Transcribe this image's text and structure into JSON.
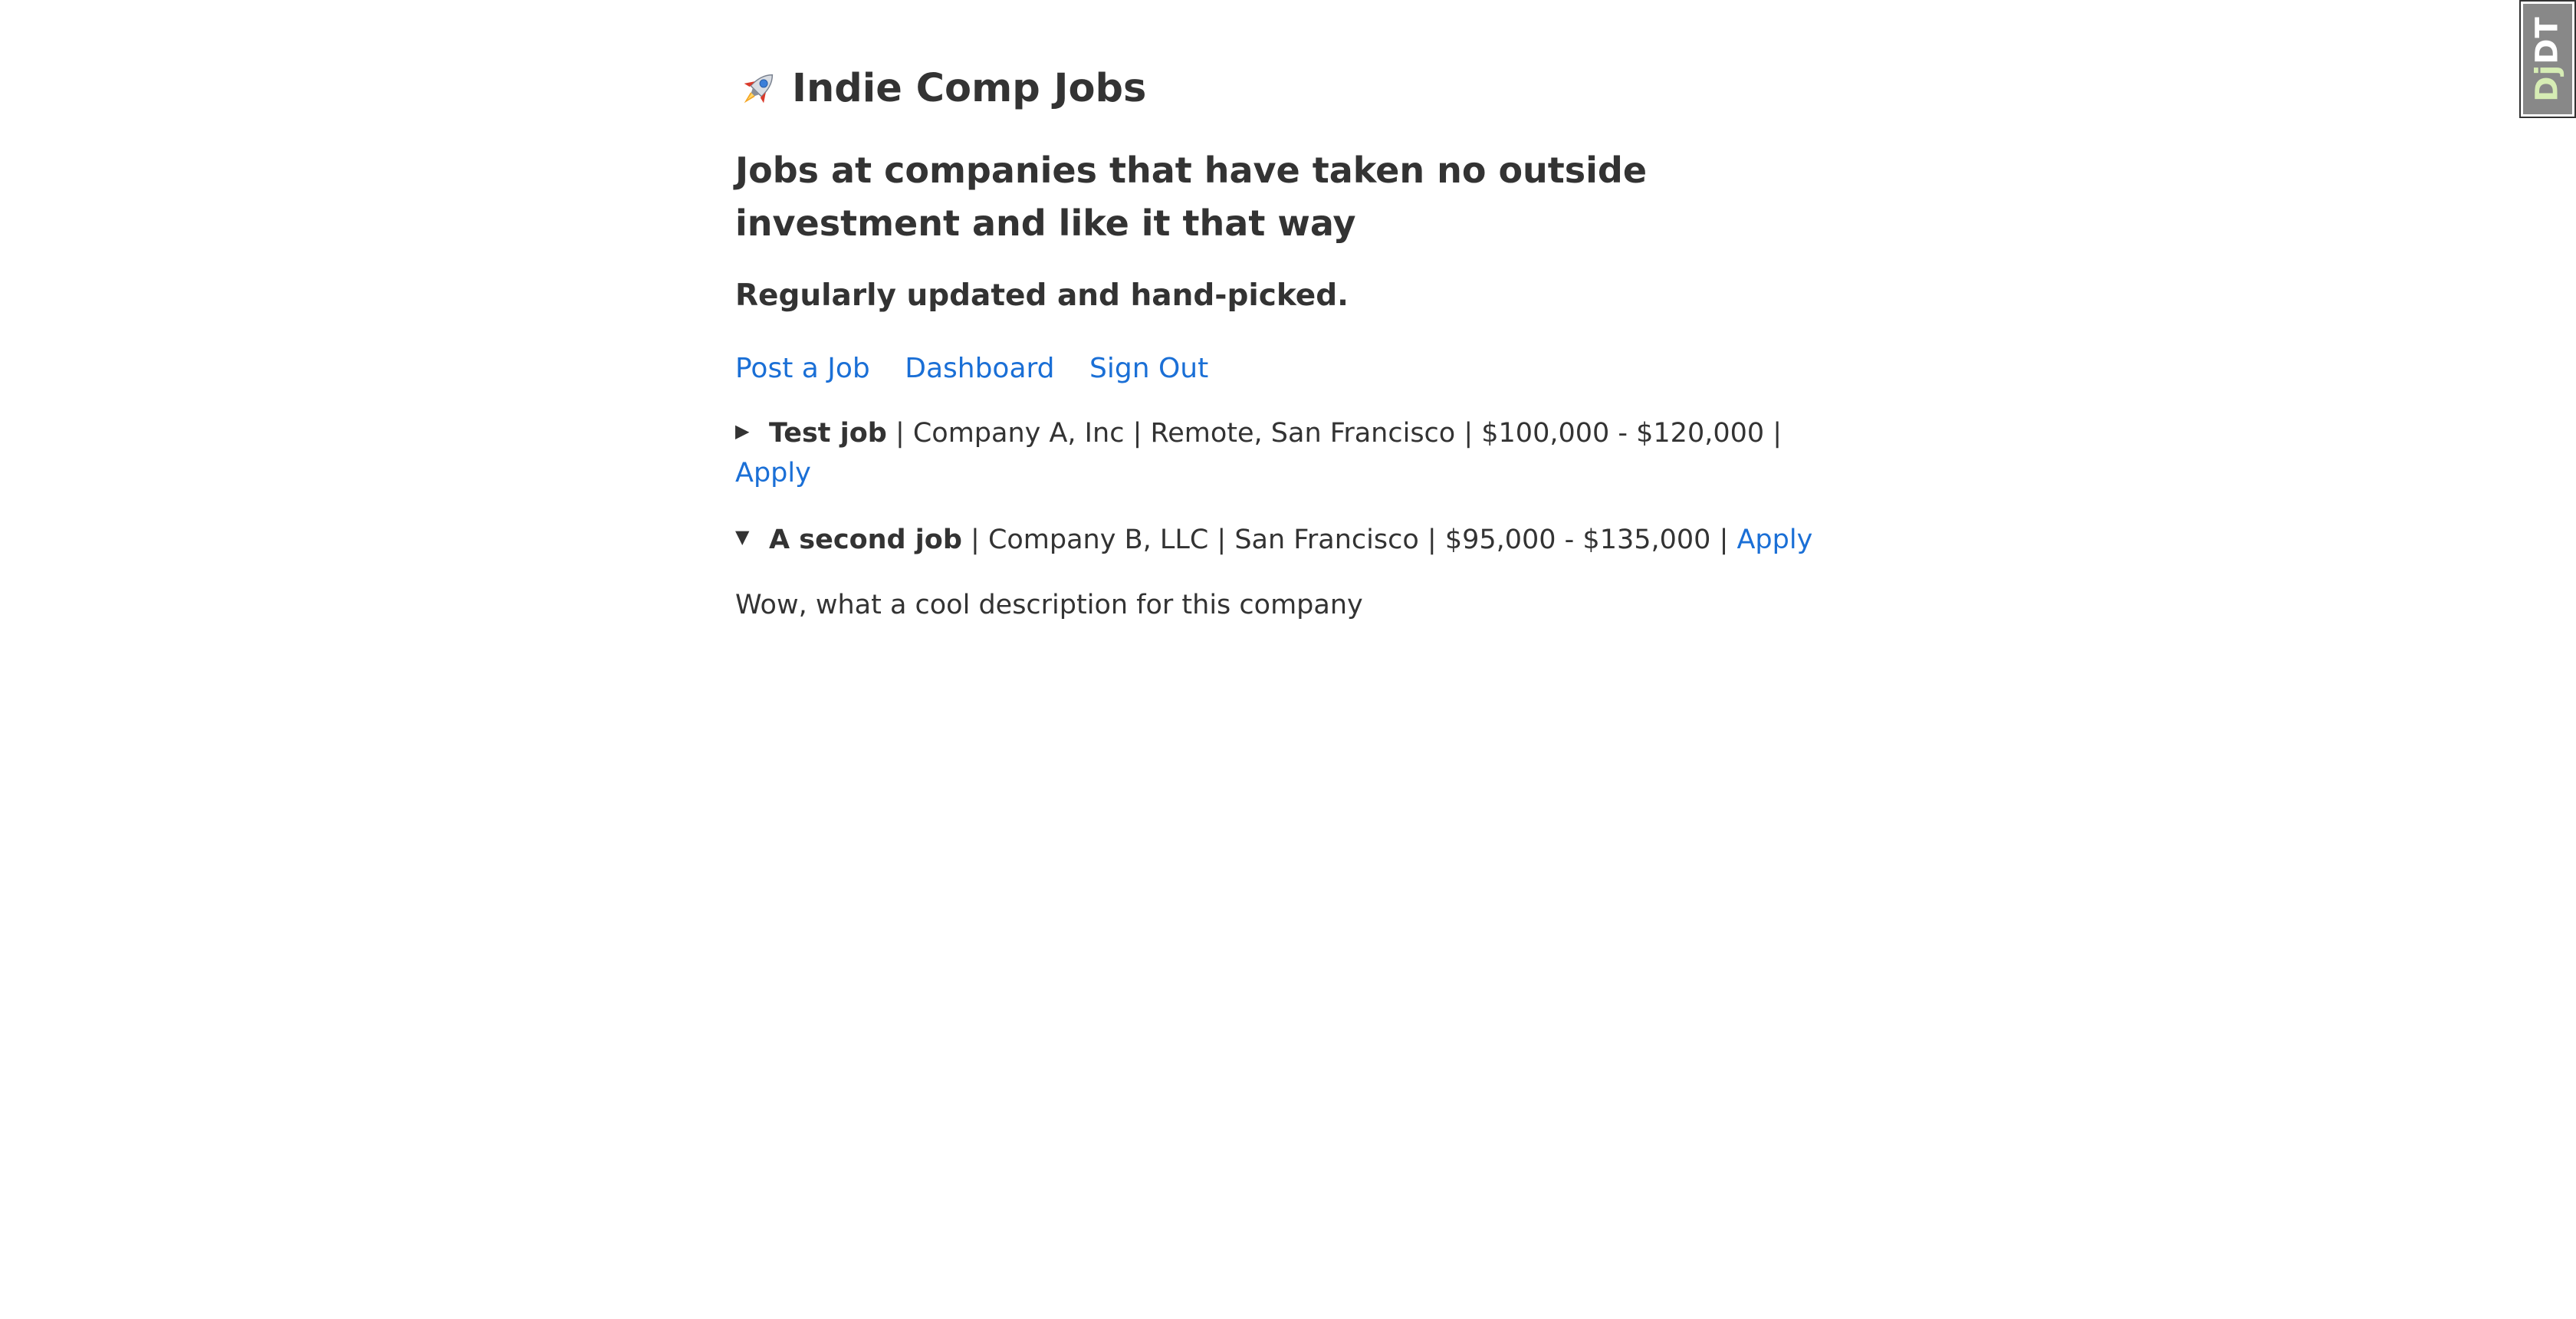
{
  "header": {
    "title": "Indie Comp Jobs",
    "tagline": "Jobs at companies that have taken no outside investment and like it that way",
    "subtagline": "Regularly updated and hand-picked."
  },
  "nav": {
    "post_job": "Post a Job",
    "dashboard": "Dashboard",
    "sign_out": "Sign Out"
  },
  "jobs": [
    {
      "marker": "▶",
      "title": "Test job",
      "company": "Company A, Inc",
      "location": "Remote, San Francisco",
      "salary": "$100,000 - $120,000",
      "apply": "Apply",
      "expanded": false
    },
    {
      "marker": "▼",
      "title": "A second job",
      "company": "Company B, LLC",
      "location": "San Francisco",
      "salary": "$95,000 - $135,000",
      "apply": "Apply",
      "expanded": true,
      "description": "Wow, what a cool description for this company"
    }
  ],
  "debug_toolbar": {
    "dj": "Dj",
    "dt": "DT"
  },
  "colors": {
    "link": "#1a6fd6",
    "text": "#333333"
  },
  "icons": {
    "title": "rocket-icon"
  }
}
